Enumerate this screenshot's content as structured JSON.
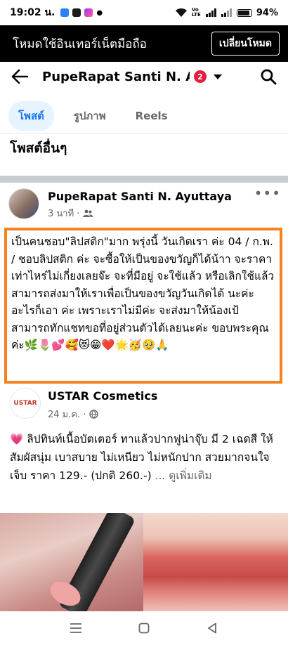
{
  "status": {
    "time": "19:02 น.",
    "volte": "Vo LTE",
    "battery": "94%"
  },
  "mode_bar": {
    "text": "โหมดใช้อินเทอร์เน็ตมือถือ",
    "button": "เปลี่ยนโหมด"
  },
  "header": {
    "title": "PupeRapat Santi N. Ay...",
    "badge": "2"
  },
  "tabs": [
    {
      "label": "โพสต์",
      "active": true
    },
    {
      "label": "รูปภาพ",
      "active": false
    },
    {
      "label": "Reels",
      "active": false
    }
  ],
  "section_title": "โพสต์อื่นๆ",
  "post": {
    "author": "PupeRapat Santi N. Ayuttaya",
    "time": "3 นาที ·",
    "text": "เป็นคนชอบ\"ลิปสติก\"มาก พรุ่งนี้ วันเกิดเรา ค่ะ 04 / ก.พ. / ชอบลิปสติก ค่ะ จะซื้อให้เป็นของขวัญก็ได้น้าา จะราคาเท่าไหร่ไม่เกี่ยงเลยจ๊ะ จะที่มีอยู่ จะใช้แล้ว หรือเลิกใช้แล้ว สามารถส่งมาให้เราเพื่อเป็นของขวัญวันเกิดได้ นะค่ะ อะไรก็เอา ค่ะ เพราะเราไม่มีค่ะ จะส่งมาให้น้องเป้ สามารถทักแชทขอที่อยู่ส่วนตัวได้เลยนะค่ะ ขอบพระคุณค่ะ🌿🌷💕🥰😻😁❤️🌟🥳🥹🙏"
  },
  "shared": {
    "logo_text": "USTAR",
    "author": "USTAR Cosmetics",
    "time": "24 ม.ค. ·",
    "heart": "💗",
    "text": " ลิปทินท์เนื้อบัตเตอร์ ทาแล้วปากฟูน่าจุ๊บ มี 2 เฉดสี ให้สัมผัสนุ่ม เบาสบาย ไม่เหนียว ไม่หนักปาก สวยมากจนใจเจ็บ ราคา 129.- (ปกติ 260.-)",
    "see_more": "... ดูเพิ่มเติม"
  },
  "colors": {
    "accent": "#1877f2",
    "highlight_border": "#f5821f",
    "badge": "#e41e3f"
  }
}
